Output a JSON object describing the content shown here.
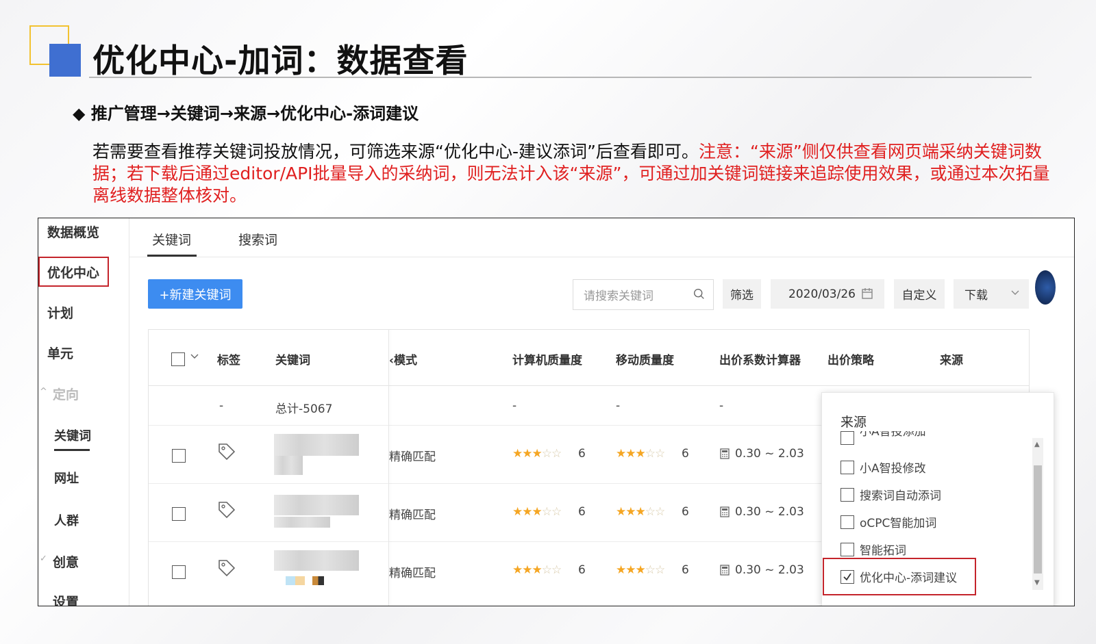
{
  "slide": {
    "title": "优化中心-加词：数据查看",
    "bullet": "◆ 推广管理→关键词→来源→优化中心-添词建议",
    "para_black": "若需要查看推荐关键词投放情况，可筛选来源“优化中心-建议添词”后查看即可。",
    "para_red": "注意：“来源”侧仅供查看网页端采纳关键词数据；若下载后通过editor/API批量导入的采纳词，则无法计入该“来源”，可通过加关键词链接来追踪使用效果，或通过本次拓量离线数据整体核对。"
  },
  "sidebar": {
    "overview": "数据概览",
    "optimize_center": "优化中心",
    "plan": "计划",
    "unit": "单元",
    "targeting": "定向",
    "keyword": "关键词",
    "url": "网址",
    "audience": "人群",
    "creative": "创意",
    "more": "设置"
  },
  "tabs": {
    "keyword": "关键词",
    "search_term": "搜索词"
  },
  "toolbar": {
    "new_keyword": "+新建关键词",
    "search_placeholder": "请搜索关键词",
    "filter": "筛选",
    "date": "2020/03/26",
    "custom": "自定义",
    "download": "下载"
  },
  "table": {
    "headers": {
      "tag": "标签",
      "keyword": "关键词",
      "match_mode": "‹模式",
      "pc_quality": "计算机质量度",
      "mobile_quality": "移动质量度",
      "bid_calc": "出价系数计算器",
      "bid_strategy": "出价策略",
      "source": "来源"
    },
    "total_row": {
      "dash": "-",
      "keyword": "总计-5067",
      "pc": "-",
      "mobile": "-",
      "bid": "-"
    },
    "rows": [
      {
        "match": "精确匹配",
        "pc_stars": 3,
        "pc_score": "6",
        "mobile_stars": 3,
        "mobile_score": "6",
        "bid_range": "0.30 ~ 2.03"
      },
      {
        "match": "精确匹配",
        "pc_stars": 3,
        "pc_score": "6",
        "mobile_stars": 3,
        "mobile_score": "6",
        "bid_range": "0.30 ~ 2.03"
      },
      {
        "match": "精确匹配",
        "pc_stars": 3,
        "pc_score": "6",
        "mobile_stars": 3,
        "mobile_score": "6",
        "bid_range": "0.30 ~ 2.03"
      }
    ]
  },
  "source_dropdown": {
    "title": "来源",
    "items": [
      {
        "label": "小A智投添加",
        "checked": false
      },
      {
        "label": "小A智投修改",
        "checked": false
      },
      {
        "label": "搜索词自动添词",
        "checked": false
      },
      {
        "label": "oCPC智能加词",
        "checked": false
      },
      {
        "label": "智能拓词",
        "checked": false
      },
      {
        "label": "优化中心-添词建议",
        "checked": true
      }
    ]
  },
  "colors": {
    "accent_blue": "#3d8cf0",
    "highlight_red": "#c4242b",
    "note_red": "#e02020",
    "star": "#f5a623"
  }
}
